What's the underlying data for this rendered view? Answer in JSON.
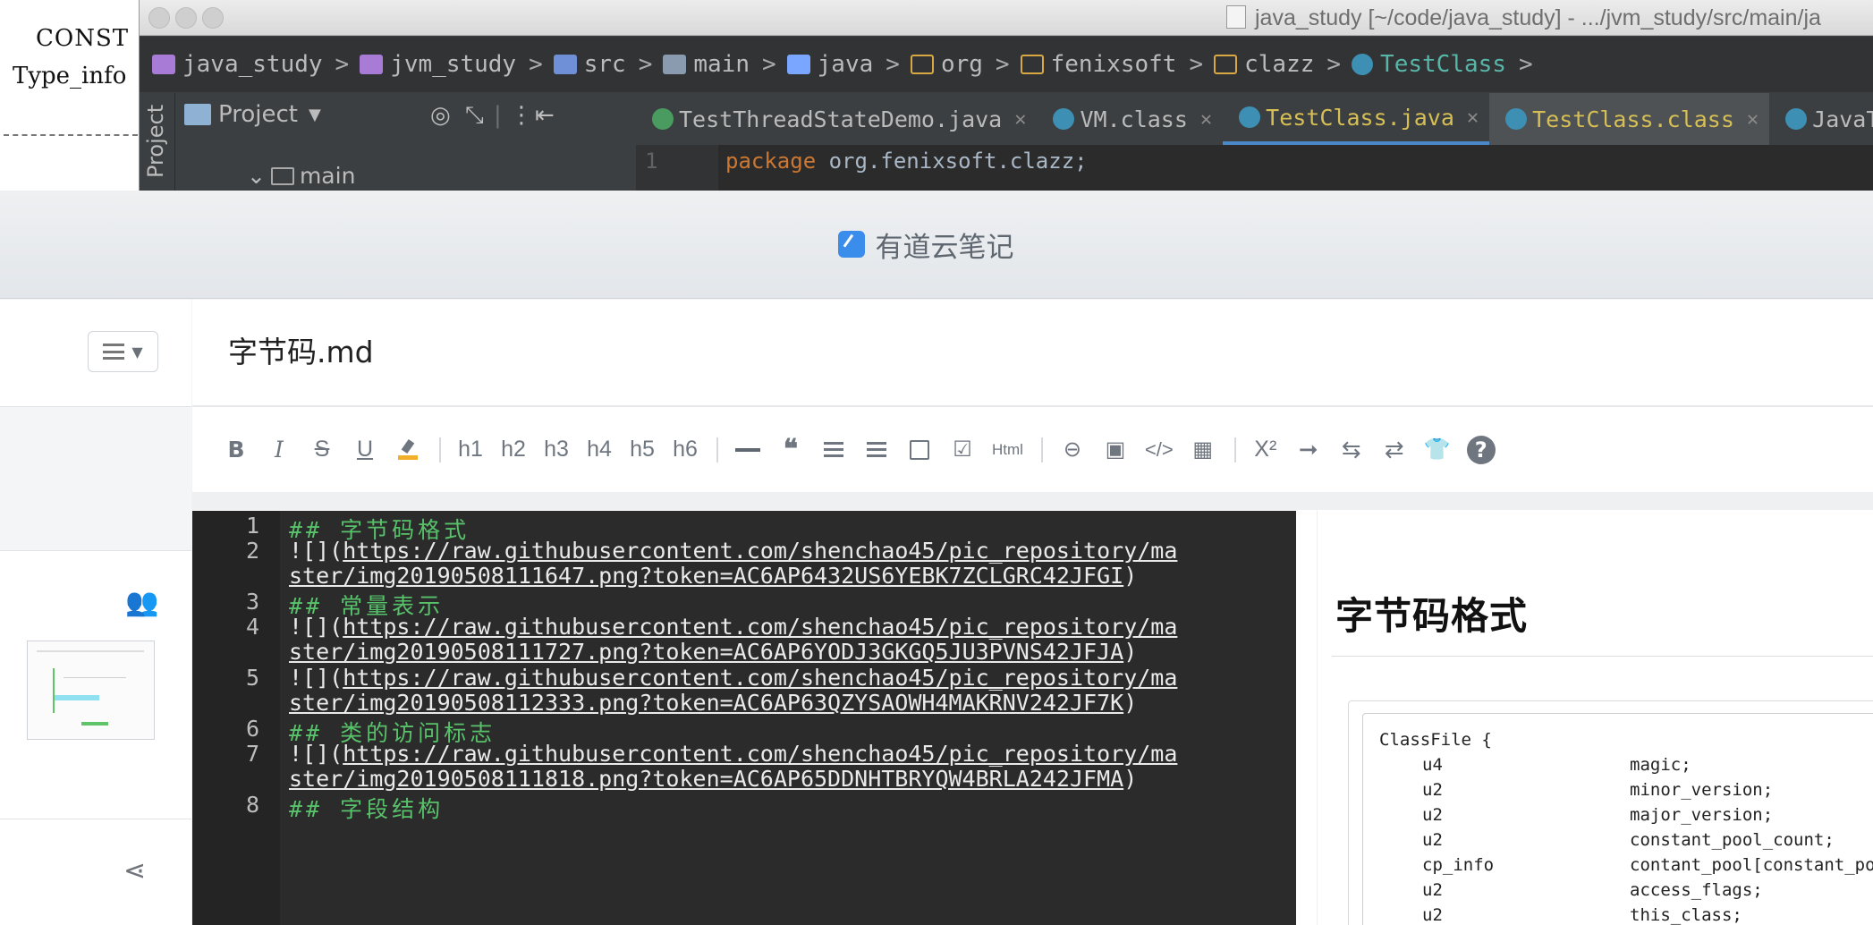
{
  "paper": {
    "line1": "CONST",
    "line2": "Type_info"
  },
  "ide": {
    "title": "java_study [~/code/java_study] - .../jvm_study/src/main/ja",
    "breadcrumbs": [
      {
        "label": "java_study",
        "icon": "module-icon"
      },
      {
        "label": "jvm_study",
        "icon": "module-icon"
      },
      {
        "label": "src",
        "icon": "source-folder-icon"
      },
      {
        "label": "main",
        "icon": "folder-icon"
      },
      {
        "label": "java",
        "icon": "java-folder-icon"
      },
      {
        "label": "org",
        "icon": "package-icon"
      },
      {
        "label": "fenixsoft",
        "icon": "package-icon"
      },
      {
        "label": "clazz",
        "icon": "package-icon"
      },
      {
        "label": "TestClass",
        "icon": "class-icon"
      }
    ],
    "project_panel": {
      "strip_label": "Project",
      "header_label": "Project",
      "tree_item": "main"
    },
    "tabs": [
      {
        "label": "TestThreadStateDemo.java"
      },
      {
        "label": "VM.class"
      },
      {
        "label": "TestClass.java"
      },
      {
        "label": "TestClass.class"
      },
      {
        "label": "JavaTh"
      }
    ],
    "editor_line_number": "1",
    "editor_line_keyword": "package",
    "editor_line_rest": " org.fenixsoft.clazz;"
  },
  "youdao": {
    "app_title": "有道云笔记",
    "note_title": "字节码.md",
    "toolbar": {
      "bold": "B",
      "italic": "I",
      "strike": "S",
      "underline": "U",
      "h1": "h1",
      "h2": "h2",
      "h3": "h3",
      "h4": "h4",
      "h5": "h5",
      "h6": "h6",
      "html": "Html",
      "superscript": "X²",
      "help": "?"
    },
    "editor_lines": [
      {
        "num": "1",
        "heading": "## 字节码格式"
      },
      {
        "num": "2",
        "prefix": "![](",
        "url1": "https://raw.githubusercontent.com/shenchao45/pic_repository/ma",
        "url2": "ster/img20190508111647.png?token=AC6AP6432US6YEBK7ZCLGRC42JFGI",
        "suffix": ")"
      },
      {
        "num": "3",
        "heading": "## 常量表示"
      },
      {
        "num": "4",
        "prefix": "![](",
        "url1": "https://raw.githubusercontent.com/shenchao45/pic_repository/ma",
        "url2": "ster/img20190508111727.png?token=AC6AP6YODJ3GKGQ5JU3PVNS42JFJA",
        "suffix": ")"
      },
      {
        "num": "5",
        "prefix": "![](",
        "url1": "https://raw.githubusercontent.com/shenchao45/pic_repository/ma",
        "url2": "ster/img20190508112333.png?token=AC6AP63QZYSAOWH4MAKRNV242JF7K",
        "suffix": ")"
      },
      {
        "num": "6",
        "heading": "## 类的访问标志"
      },
      {
        "num": "7",
        "prefix": "![](",
        "url1": "https://raw.githubusercontent.com/shenchao45/pic_repository/ma",
        "url2": "ster/img20190508111818.png?token=AC6AP65DDNHTBRYQW4BRLA242JFMA",
        "suffix": ")"
      },
      {
        "num": "8",
        "heading": "## 字段结构"
      }
    ],
    "preview": {
      "h1": "字节码格式",
      "code_lines": [
        {
          "type": "ClassFile {",
          "name": ""
        },
        {
          "type": "u4",
          "name": "magic;"
        },
        {
          "type": "u2",
          "name": "minor_version;"
        },
        {
          "type": "u2",
          "name": "major_version;"
        },
        {
          "type": "u2",
          "name": "constant_pool_count;"
        },
        {
          "type": "cp_info",
          "name": "contant_pool[constant_po"
        },
        {
          "type": "u2",
          "name": "access_flags;"
        },
        {
          "type": "u2",
          "name": "this_class;"
        }
      ]
    }
  },
  "colors": {
    "ide_bg": "#3c3f41",
    "editor_bg": "#2b2b2b",
    "heading_green": "#58c26b",
    "tab_active_text": "#d6bf55",
    "crumb_active": "#58b6a8",
    "youdao_blue": "#3a8dea"
  }
}
